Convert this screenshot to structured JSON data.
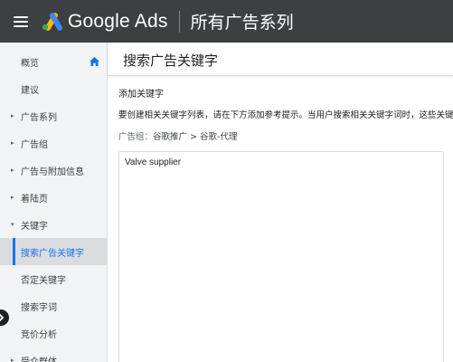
{
  "app": {
    "brand": "Google Ads",
    "section_title": "所有广告系列"
  },
  "sidebar": {
    "items": [
      {
        "label": "概览"
      },
      {
        "label": "建议"
      },
      {
        "label": "广告系列"
      },
      {
        "label": "广告组"
      },
      {
        "label": "广告与附加信息"
      },
      {
        "label": "着陆页"
      },
      {
        "label": "关键字"
      },
      {
        "label": "搜索广告关键字"
      },
      {
        "label": "否定关键字"
      },
      {
        "label": "搜索字词"
      },
      {
        "label": "竞价分析"
      },
      {
        "label": "受众群体"
      }
    ]
  },
  "main": {
    "page_title": "搜索广告关键字",
    "section_title": "添加关键字",
    "instructions": "要创建相关关键字列表，请在下方添加参考提示。当用户搜索相关关键字词时，这些关键字",
    "breadcrumb_label": "广告组：",
    "breadcrumb_value": "谷歌推广 > 谷歌-代理",
    "keyword_text": "Valve supplier"
  },
  "colors": {
    "topbar": "#3c4043",
    "accent": "#1a73e8",
    "sidebar_bg": "#f1f3f4"
  }
}
